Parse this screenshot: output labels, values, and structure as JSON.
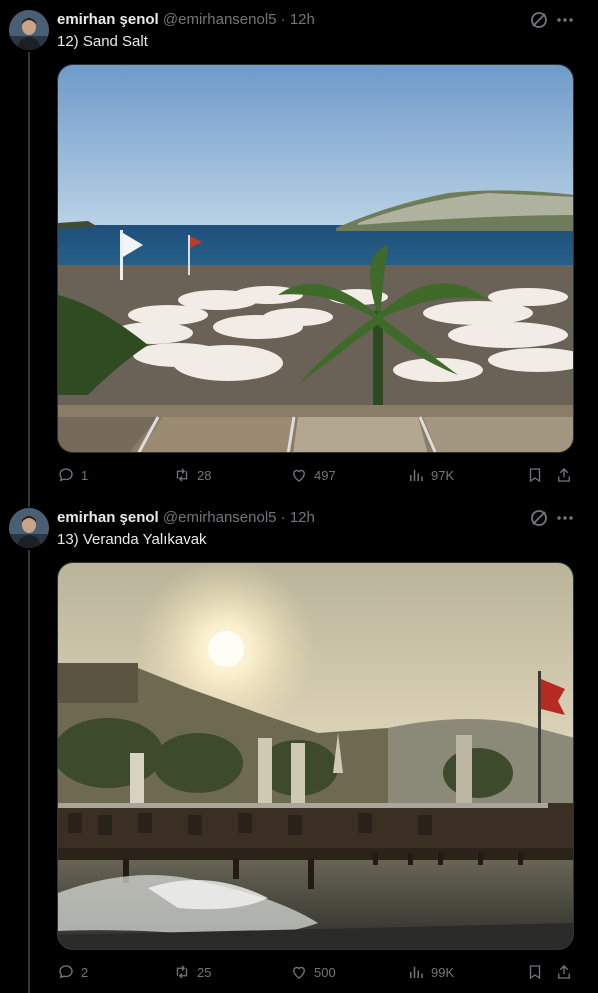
{
  "tweets": [
    {
      "author_name": "emirhan şenol",
      "handle": "@emirhansenol5",
      "separator": "·",
      "time": "12h",
      "text": "12) Sand Salt",
      "stats": {
        "replies": "1",
        "retweets": "28",
        "likes": "497",
        "views": "97K"
      }
    },
    {
      "author_name": "emirhan şenol",
      "handle": "@emirhansenol5",
      "separator": "·",
      "time": "12h",
      "text": "13) Veranda Yalıkavak",
      "stats": {
        "replies": "2",
        "retweets": "25",
        "likes": "500",
        "views": "99K"
      }
    }
  ],
  "icons": [
    "avatar",
    "grok-icon",
    "more-icon",
    "reply-icon",
    "retweet-icon",
    "like-icon",
    "views-icon",
    "bookmark-icon",
    "share-icon"
  ],
  "colors": {
    "background": "#000000",
    "text": "#e7e9ea",
    "muted": "#71767b",
    "thread_line": "#333639"
  }
}
